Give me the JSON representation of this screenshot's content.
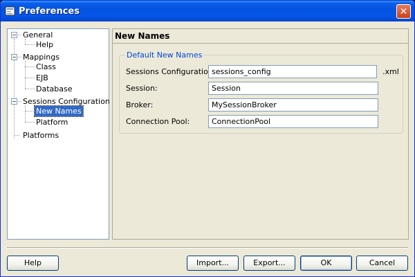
{
  "window": {
    "title": "Preferences",
    "app_icon": "preferences-app-icon",
    "close_icon": "close-icon",
    "close_glyph": "✕"
  },
  "tree": {
    "expander_expanded_glyph": "−",
    "items": [
      {
        "label": "General",
        "depth": 0,
        "expanded": true
      },
      {
        "label": "Help",
        "depth": 1
      },
      {
        "label": "Mappings",
        "depth": 0,
        "expanded": true
      },
      {
        "label": "Class",
        "depth": 1
      },
      {
        "label": "EJB",
        "depth": 1
      },
      {
        "label": "Database",
        "depth": 1
      },
      {
        "label": "Sessions Configuration",
        "depth": 0,
        "expanded": true
      },
      {
        "label": "New Names",
        "depth": 1,
        "selected": true
      },
      {
        "label": "Platform",
        "depth": 1
      },
      {
        "label": "Platforms",
        "depth": 0
      }
    ]
  },
  "panel": {
    "title": "New Names",
    "group_title": "Default New Names",
    "fields": [
      {
        "label": "Sessions Configuration:",
        "value": "sessions_config",
        "suffix": ".xml"
      },
      {
        "label": "Session:",
        "value": "Session"
      },
      {
        "label": "Broker:",
        "value": "MySessionBroker"
      },
      {
        "label": "Connection Pool:",
        "value": "ConnectionPool"
      }
    ]
  },
  "buttons": {
    "help": "Help",
    "import": "Import...",
    "export": "Export...",
    "ok": "OK",
    "cancel": "Cancel"
  },
  "colors": {
    "title_bar": "#0553e0",
    "selection": "#316ac5",
    "group_title": "#0046d5",
    "close_button": "#c8411a"
  }
}
